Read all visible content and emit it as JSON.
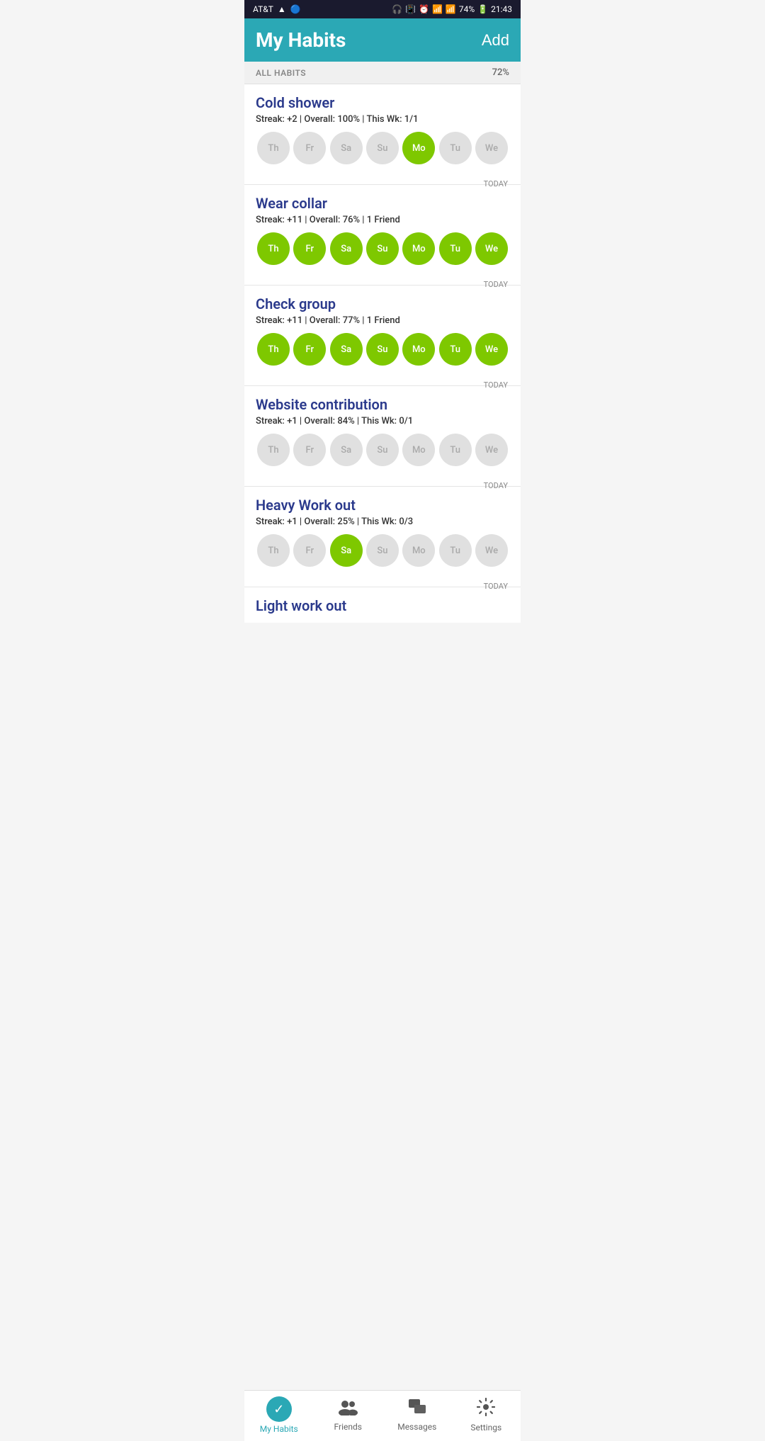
{
  "statusBar": {
    "carrier": "AT&T",
    "warning": "▲",
    "droplet": "💧",
    "battery": "74%",
    "time": "21:43"
  },
  "header": {
    "title": "My Habits",
    "addButton": "Add"
  },
  "allHabits": {
    "label": "ALL HABITS",
    "percent": "72%"
  },
  "habits": [
    {
      "name": "Cold shower",
      "stats": "Streak: +2  |  Overall: 100%  |  This Wk: 1/1",
      "days": [
        {
          "label": "Th",
          "active": false
        },
        {
          "label": "Fr",
          "active": false
        },
        {
          "label": "Sa",
          "active": false
        },
        {
          "label": "Su",
          "active": false
        },
        {
          "label": "Mo",
          "active": true
        },
        {
          "label": "Tu",
          "active": false
        },
        {
          "label": "We",
          "active": false
        }
      ]
    },
    {
      "name": "Wear collar",
      "stats": "Streak: +11  |  Overall: 76%  |  1 Friend",
      "days": [
        {
          "label": "Th",
          "active": true
        },
        {
          "label": "Fr",
          "active": true
        },
        {
          "label": "Sa",
          "active": true
        },
        {
          "label": "Su",
          "active": true
        },
        {
          "label": "Mo",
          "active": true
        },
        {
          "label": "Tu",
          "active": true
        },
        {
          "label": "We",
          "active": true
        }
      ]
    },
    {
      "name": "Check group",
      "stats": "Streak: +11  |  Overall: 77%  |  1 Friend",
      "days": [
        {
          "label": "Th",
          "active": true
        },
        {
          "label": "Fr",
          "active": true
        },
        {
          "label": "Sa",
          "active": true
        },
        {
          "label": "Su",
          "active": true
        },
        {
          "label": "Mo",
          "active": true
        },
        {
          "label": "Tu",
          "active": true
        },
        {
          "label": "We",
          "active": true
        }
      ]
    },
    {
      "name": "Website contribution",
      "stats": "Streak: +1  |  Overall: 84%  |  This Wk: 0/1",
      "days": [
        {
          "label": "Th",
          "active": false
        },
        {
          "label": "Fr",
          "active": false
        },
        {
          "label": "Sa",
          "active": false
        },
        {
          "label": "Su",
          "active": false
        },
        {
          "label": "Mo",
          "active": false
        },
        {
          "label": "Tu",
          "active": false
        },
        {
          "label": "We",
          "active": false
        }
      ]
    },
    {
      "name": "Heavy Work out",
      "stats": "Streak: +1  |  Overall: 25%  |  This Wk: 0/3",
      "days": [
        {
          "label": "Th",
          "active": false
        },
        {
          "label": "Fr",
          "active": false
        },
        {
          "label": "Sa",
          "active": true
        },
        {
          "label": "Su",
          "active": false
        },
        {
          "label": "Mo",
          "active": false
        },
        {
          "label": "Tu",
          "active": false
        },
        {
          "label": "We",
          "active": false
        }
      ]
    }
  ],
  "partialHabit": {
    "name": "Light work out"
  },
  "bottomNav": [
    {
      "id": "my-habits",
      "label": "My Habits",
      "icon": "check",
      "active": true
    },
    {
      "id": "friends",
      "label": "Friends",
      "icon": "friends",
      "active": false
    },
    {
      "id": "messages",
      "label": "Messages",
      "icon": "messages",
      "active": false
    },
    {
      "id": "settings",
      "label": "Settings",
      "icon": "settings",
      "active": false
    }
  ],
  "todayLabel": "TODAY"
}
